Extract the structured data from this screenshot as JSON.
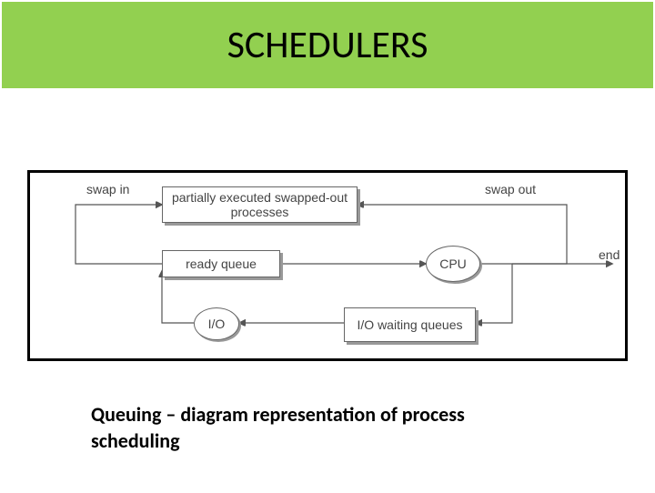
{
  "title": "SCHEDULERS",
  "caption": "Queuing – diagram representation of process scheduling",
  "diagram": {
    "partially": "partially executed swapped-out processes",
    "ready": "ready queue",
    "cpu": "CPU",
    "io": "I/O",
    "iowait": "I/O waiting queues",
    "swap_in": "swap in",
    "swap_out": "swap out",
    "end": "end"
  }
}
